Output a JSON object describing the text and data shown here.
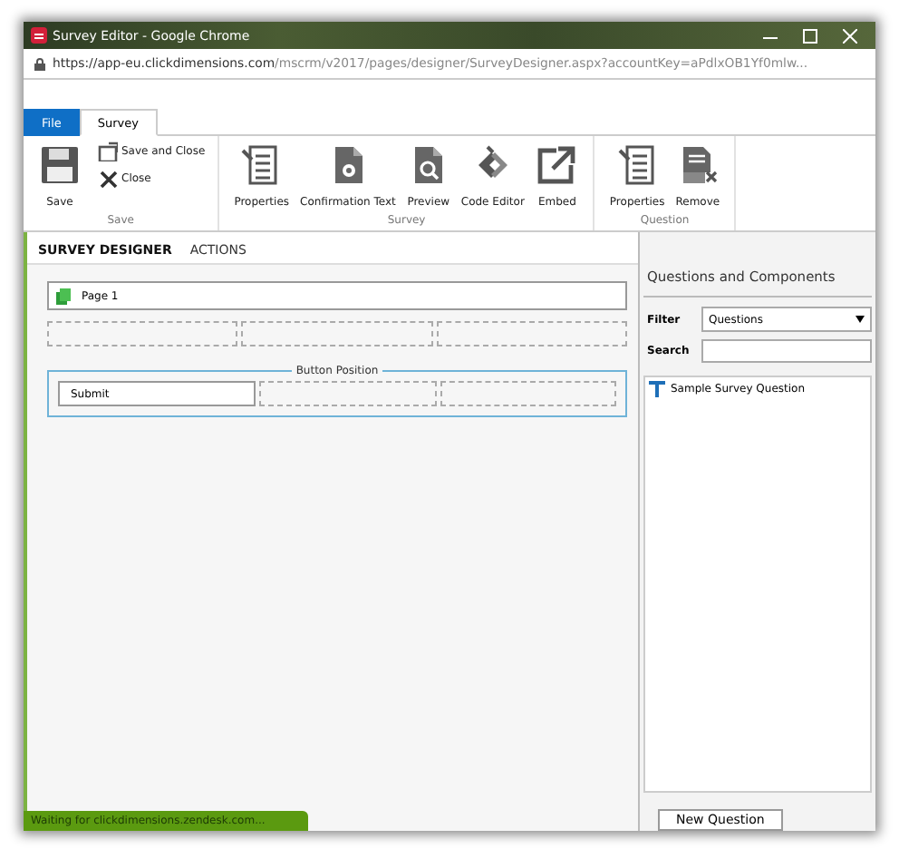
{
  "window": {
    "title": "Survey Editor - Google Chrome"
  },
  "address": {
    "host": "https://app-eu.clickdimensions.com",
    "path": "/mscrm/v2017/pages/designer/SurveyDesigner.aspx?accountKey=aPdlxOB1Yf0mlw..."
  },
  "tabs": [
    {
      "label": "File",
      "selected": false
    },
    {
      "label": "Survey",
      "selected": true
    }
  ],
  "ribbon": [
    {
      "label": "Save",
      "buttons": [
        {
          "kind": "large",
          "label": "Save"
        },
        {
          "kind": "small",
          "label": "Save and Close"
        },
        {
          "kind": "small",
          "label": "Close"
        }
      ]
    },
    {
      "label": "Survey",
      "buttons": [
        {
          "kind": "large",
          "label": "Properties"
        },
        {
          "kind": "large",
          "label": "Confirmation Text"
        },
        {
          "kind": "large",
          "label": "Preview"
        },
        {
          "kind": "large",
          "label": "Code Editor"
        },
        {
          "kind": "large",
          "label": "Embed"
        }
      ]
    },
    {
      "label": "Question",
      "buttons": [
        {
          "kind": "large",
          "label": "Properties"
        },
        {
          "kind": "large",
          "label": "Remove"
        }
      ]
    }
  ],
  "designer": {
    "tabs": [
      {
        "label": "SURVEY DESIGNER",
        "selected": true
      },
      {
        "label": "ACTIONS",
        "selected": false
      }
    ],
    "page": "Page 1",
    "button_position": "Button Position",
    "submit": "Submit"
  },
  "panel": {
    "title": "Questions and Components",
    "filter_label": "Filter",
    "filter_value": "Questions",
    "search_label": "Search",
    "items": [
      "Sample Survey Question"
    ],
    "button": "New Question"
  },
  "status": "Waiting for clickdimensions.zendesk.com..."
}
